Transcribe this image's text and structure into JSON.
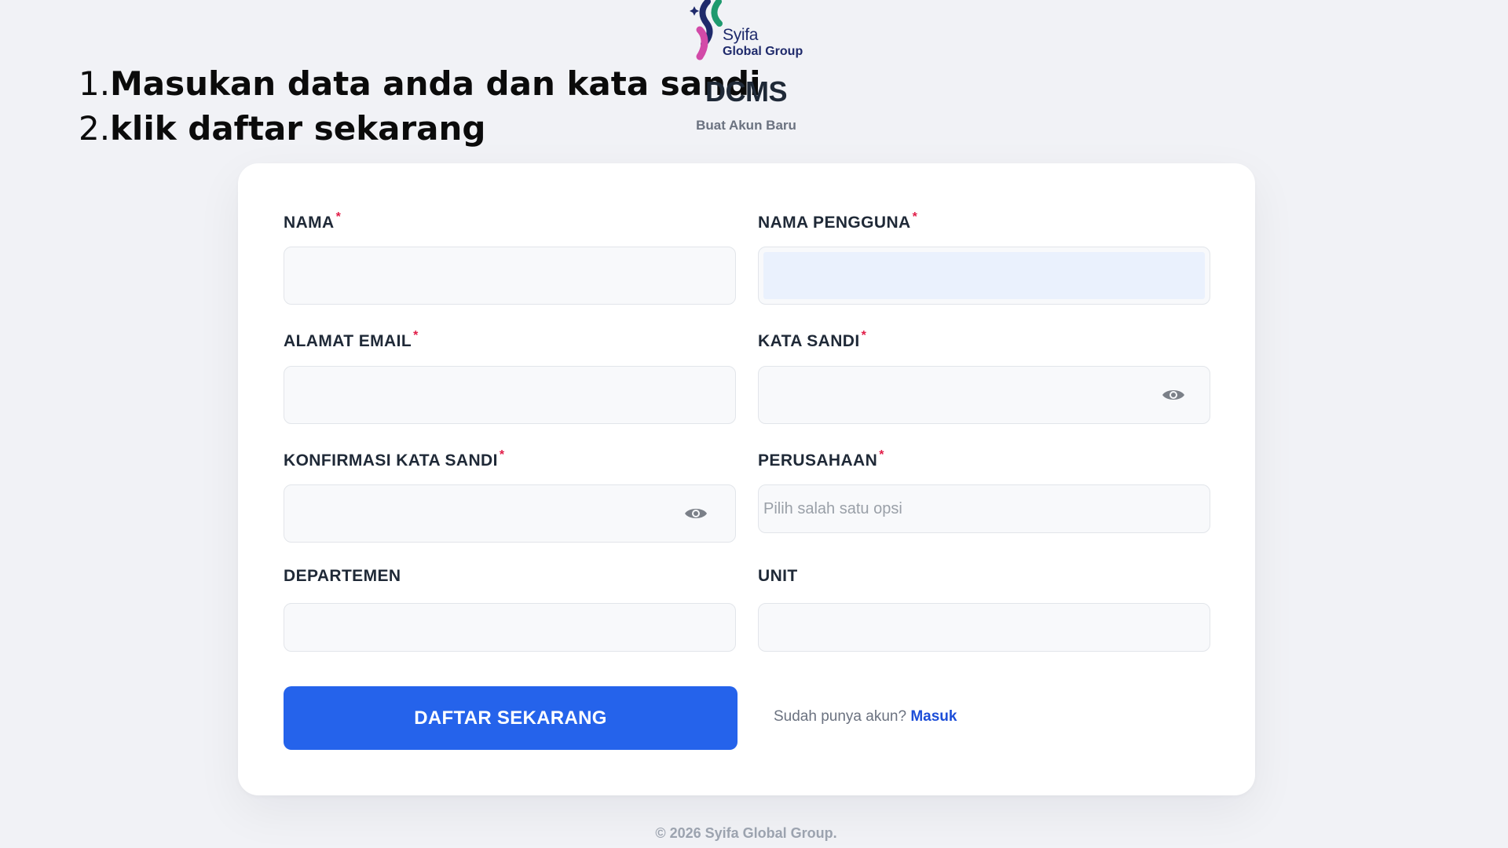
{
  "instructions": [
    {
      "num": "1.",
      "text": "Masukan data anda dan kata sandi"
    },
    {
      "num": "2.",
      "text": "klik daftar sekarang"
    }
  ],
  "brand": {
    "logo_word": "Syifa",
    "logo_group": "Global Group",
    "title": "DCMS",
    "subtitle": "Buat Akun Baru"
  },
  "form": {
    "required_mark": "*",
    "fields": {
      "nama": {
        "label": "NAMA",
        "value": ""
      },
      "nama_pengguna": {
        "label": "NAMA PENGGUNA",
        "value": ""
      },
      "alamat_email": {
        "label": "ALAMAT EMAIL",
        "value": ""
      },
      "kata_sandi": {
        "label": "KATA SANDI",
        "value": ""
      },
      "konfirmasi_kata_sandi": {
        "label": "KONFIRMASI KATA SANDI",
        "value": ""
      },
      "perusahaan": {
        "label": "PERUSAHAAN",
        "placeholder": "Pilih salah satu opsi"
      },
      "departemen": {
        "label": "DEPARTEMEN",
        "value": ""
      },
      "unit": {
        "label": "UNIT",
        "value": ""
      }
    },
    "submit_label": "DAFTAR SEKARANG",
    "login_prompt": "Sudah punya akun?",
    "login_link": "Masuk"
  },
  "footer": "© 2026 Syifa Global Group.",
  "colors": {
    "primary": "#2563eb",
    "link": "#1d4ed8",
    "required": "#e11d48",
    "page_background": "#f1f2f6"
  },
  "icons": {
    "password_toggle": "eye-icon",
    "logo_mark": "syifa-logo-icon",
    "sparkle": "sparkle-icon"
  }
}
